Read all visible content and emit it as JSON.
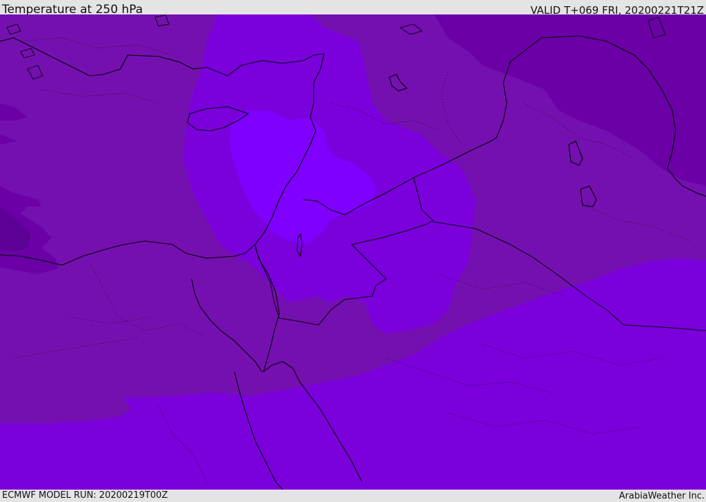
{
  "header": {
    "title": "Temperature at 250 hPa",
    "valid_time": "VALID T+069 FRI, 20200221T21Z"
  },
  "footer": {
    "model_run": "ECMWF MODEL RUN: 20200219T00Z",
    "credit": "ArabiaWeather Inc."
  },
  "colors": {
    "background": "#7510b0",
    "darker_band": "#6a00a5",
    "darkest_band": "#5c0096",
    "warm_band": "#7a00dc",
    "warmest_band": "#7f00ff",
    "coastline": "#000000",
    "border": "#000000"
  },
  "icons": []
}
